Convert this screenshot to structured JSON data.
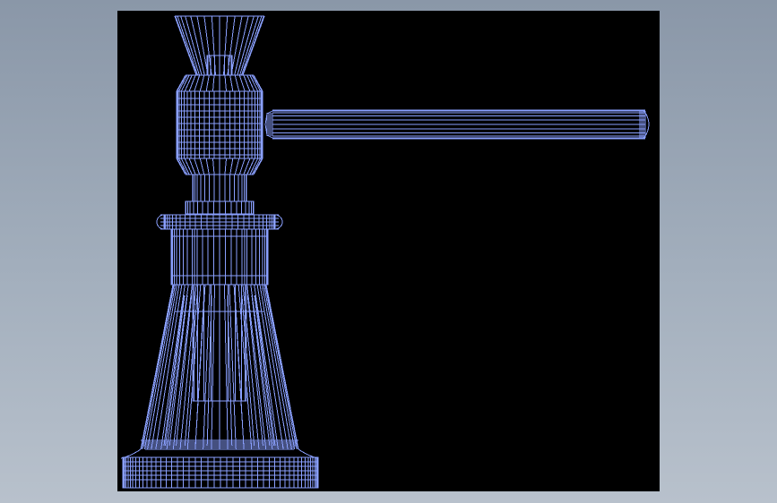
{
  "viewport": {
    "background": "#000000",
    "wire_color": "#8aa0ff",
    "page_background": "#9aa6b5"
  },
  "model": {
    "icon": "screw-jack-wireframe-icon",
    "parts": [
      "top-cap",
      "head-block",
      "lever-handle",
      "screw-shaft",
      "collar-ring",
      "nut-body",
      "conical-base",
      "base-plate"
    ]
  }
}
